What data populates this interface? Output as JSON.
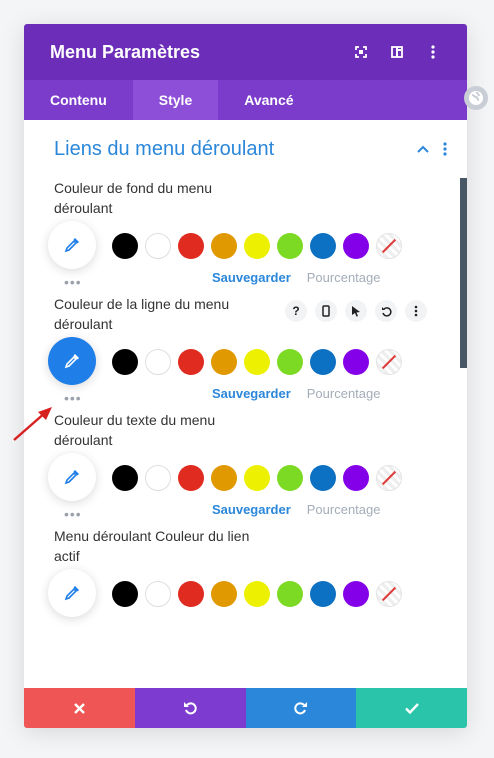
{
  "header": {
    "title": "Menu Paramètres",
    "icons": [
      "fullscreen-icon",
      "split-view-icon",
      "more-vertical-icon"
    ]
  },
  "tabs": [
    {
      "label": "Contenu",
      "active": false
    },
    {
      "label": "Style",
      "active": true
    },
    {
      "label": "Avancé",
      "active": false
    }
  ],
  "section": {
    "title": "Liens du menu déroulant"
  },
  "palette": [
    "#000000",
    "#ffffff",
    "#e02b20",
    "#e09900",
    "#edf000",
    "#7cda24",
    "#0c71c3",
    "#8300e9"
  ],
  "actions": {
    "save_label": "Sauvegarder",
    "percent_label": "Pourcentage"
  },
  "fields": [
    {
      "label": "Couleur de fond du menu déroulant",
      "active": false
    },
    {
      "label": "Couleur de la ligne du menu déroulant",
      "active": true
    },
    {
      "label": "Couleur du texte du menu déroulant",
      "active": false
    },
    {
      "label": "Menu déroulant Couleur du lien actif",
      "active": false
    }
  ],
  "field_toolbar": {
    "help": "?"
  },
  "footer": {
    "colors": {
      "cancel": "#ef5555",
      "undo": "#7e3bd0",
      "redo": "#2b87da",
      "save": "#29c4a9"
    }
  },
  "colors": {
    "header_bg": "#6c2eb9",
    "tabs_bg": "#7b3ccb",
    "accent": "#2b87da"
  }
}
